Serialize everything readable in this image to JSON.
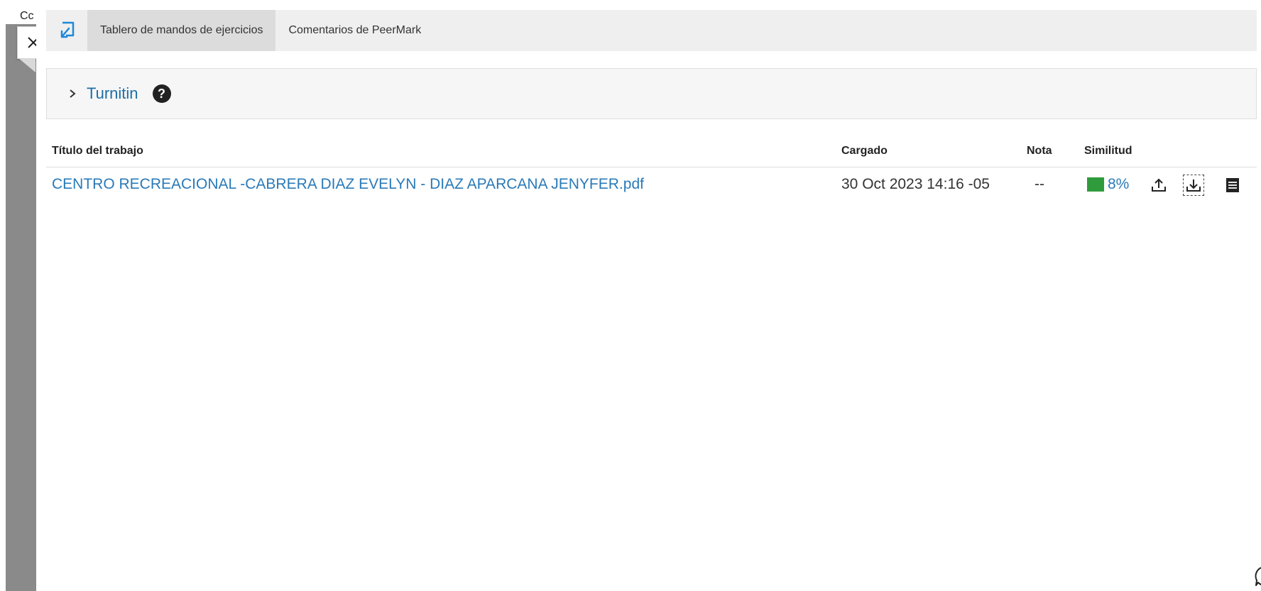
{
  "app": {
    "left_fragment": "Cc"
  },
  "tabs": [
    {
      "label": "Tablero de mandos de ejercicios",
      "active": true
    },
    {
      "label": "Comentarios de PeerMark",
      "active": false
    }
  ],
  "panel": {
    "title": "Turnitin",
    "help_glyph": "?"
  },
  "table": {
    "headers": {
      "title": "Título del trabajo",
      "uploaded": "Cargado",
      "grade": "Nota",
      "similarity": "Similitud"
    },
    "rows": [
      {
        "title": "CENTRO RECREACIONAL -CABRERA DIAZ EVELYN - DIAZ APARCANA JENYFER.pdf",
        "uploaded": "30 Oct 2023 14:16 -05",
        "grade": "--",
        "similarity": "8%"
      }
    ]
  },
  "colors": {
    "link": "#2a7ab8",
    "similarity_low": "#2f9b3c",
    "accent": "#1e88d8"
  },
  "icons": {
    "close": "close-icon",
    "tab_app": "exit-arrow-icon",
    "expand": "chevron-right-icon",
    "help": "question-circle-icon",
    "upload": "upload-icon",
    "download": "download-icon",
    "details": "document-list-icon",
    "bottom_help": "help-outline-icon"
  }
}
